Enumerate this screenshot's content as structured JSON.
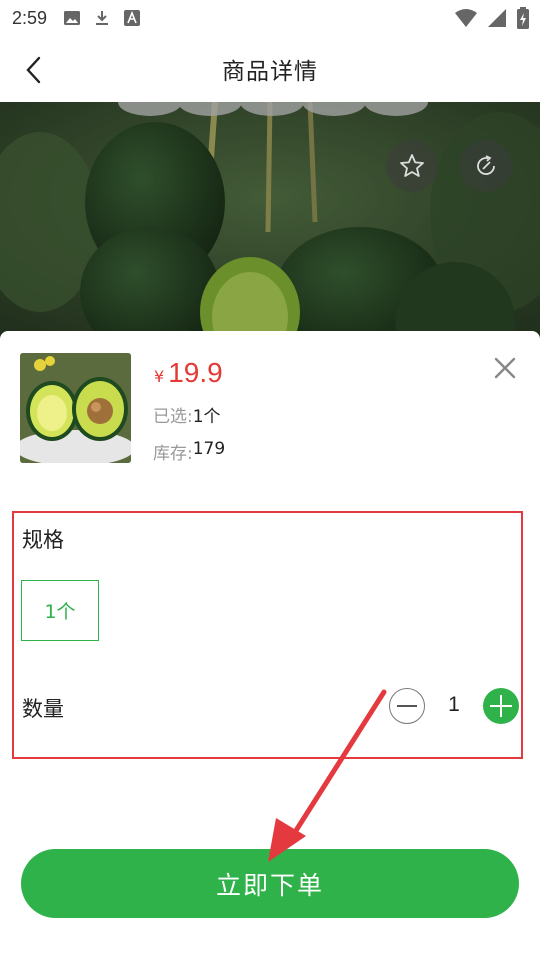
{
  "status_bar": {
    "time": "2:59",
    "left_icons": [
      "image-icon",
      "download-icon",
      "font-icon"
    ],
    "right_icons": [
      "wifi-icon",
      "signal-icon",
      "battery-icon"
    ]
  },
  "header": {
    "title": "商品详情",
    "back_icon": "chevron-left-icon"
  },
  "hero": {
    "favorite_icon": "star-icon",
    "share_icon": "share-icon"
  },
  "product": {
    "currency_symbol": "¥",
    "price": "19.9",
    "selected_label": "已选:",
    "selected_value": "1个",
    "stock_label": "库存:",
    "stock_value": "179"
  },
  "spec": {
    "title": "规格",
    "options": [
      "1个"
    ],
    "selected": "1个"
  },
  "quantity": {
    "title": "数量",
    "value": "1"
  },
  "buy_button": {
    "label": "立即下单"
  },
  "colors": {
    "accent_green": "#2fb24a",
    "price_red": "#e53935",
    "highlight_red": "#e53940"
  }
}
